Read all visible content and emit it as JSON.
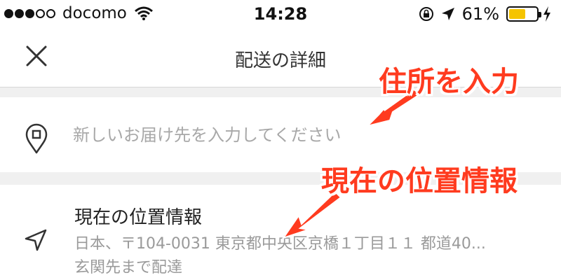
{
  "status_bar": {
    "carrier": "docomo",
    "time": "14:28",
    "battery_percent": "61%",
    "battery_level": 0.61,
    "battery_color": "#f5c400",
    "icons": [
      "signal-dots-icon",
      "wifi-icon",
      "rotation-lock-icon",
      "location-arrow-icon",
      "battery-icon",
      "charging-bolt-icon"
    ]
  },
  "header": {
    "title": "配送の詳細",
    "close_icon": "close-icon"
  },
  "address": {
    "placeholder": "新しいお届け先を入力してください",
    "value": "",
    "icon": "map-pin-icon"
  },
  "current_location": {
    "icon": "navigation-arrow-icon",
    "title": "現在の位置情報",
    "address": "日本、〒104-0031 東京都中央区京橋１丁目１１ 都道40...",
    "note": "玄関先まで配達"
  },
  "annotations": {
    "address_label": "住所を入力",
    "location_label": "現在の位置情報",
    "color": "#ff3b1f"
  }
}
